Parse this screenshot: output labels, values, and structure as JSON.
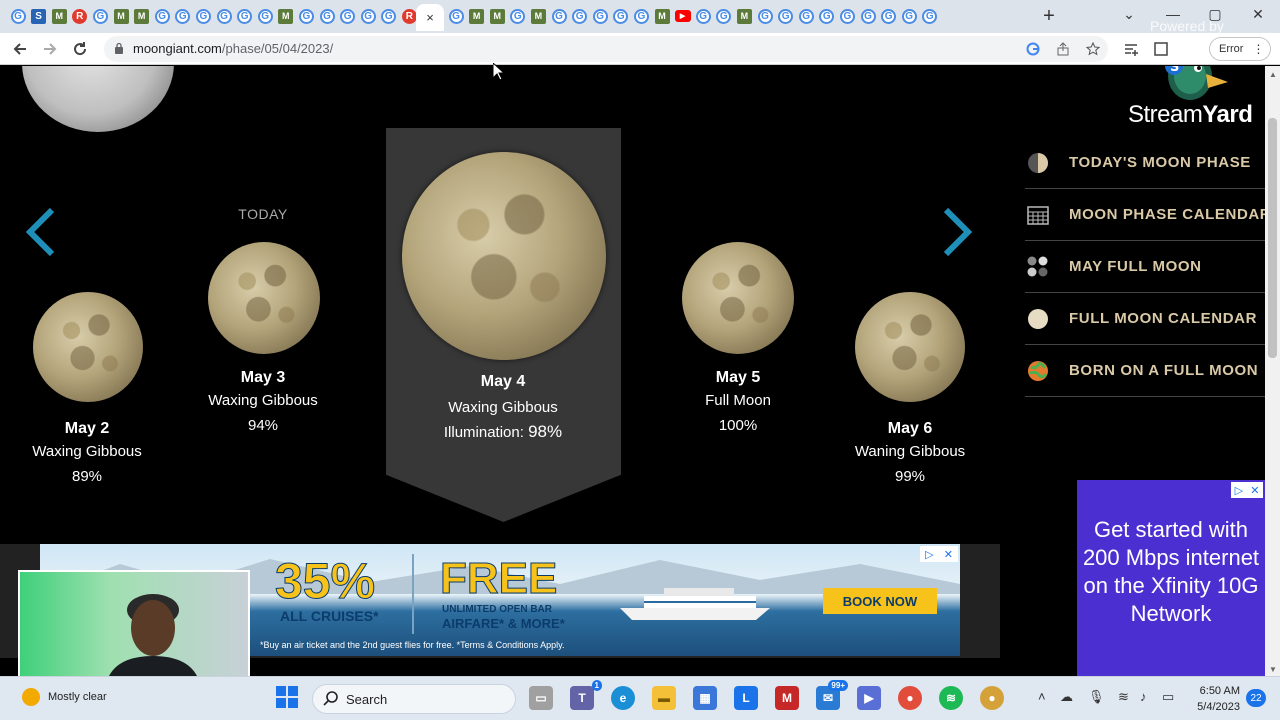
{
  "browser": {
    "tab_favicons": [
      "G",
      "S",
      "M",
      "R",
      "G",
      "M",
      "M",
      "G",
      "G",
      "G",
      "G",
      "G",
      "G",
      "M",
      "G",
      "G",
      "G",
      "G",
      "G",
      "R",
      "active",
      "G",
      "M",
      "M",
      "G",
      "M",
      "G",
      "G",
      "G",
      "G",
      "G",
      "M",
      "YT",
      "G",
      "G",
      "M",
      "G",
      "G",
      "G",
      "G",
      "G",
      "G",
      "G",
      "G",
      "G"
    ],
    "active_tab_close": "×",
    "new_tab": "+",
    "window_controls": {
      "minimize": "—",
      "maximize": "▢",
      "close": "✕",
      "dropdown": "⌄"
    },
    "overlay_text": "Powered by",
    "url_host": "moongiant.com",
    "url_path": "/phase/05/04/2023/",
    "error_chip": "Error"
  },
  "carousel": {
    "today_label": "TODAY",
    "days": [
      {
        "date": "May 2",
        "phase": "Waxing Gibbous",
        "illumination": "89%"
      },
      {
        "date": "May 3",
        "phase": "Waxing Gibbous",
        "illumination": "94%"
      },
      {
        "date": "May 4",
        "phase": "Waxing Gibbous",
        "illumination_label": "Illumination:",
        "illumination": "98%"
      },
      {
        "date": "May 5",
        "phase": "Full Moon",
        "illumination": "100%"
      },
      {
        "date": "May 6",
        "phase": "Waning Gibbous",
        "illumination": "99%"
      }
    ]
  },
  "sidebar": {
    "items": [
      {
        "label": "TODAY'S MOON PHASE",
        "icon": "half-moon-icon"
      },
      {
        "label": "MOON PHASE CALENDAR",
        "icon": "calendar-grid-icon"
      },
      {
        "label": "MAY FULL MOON",
        "icon": "moon-phases-icon"
      },
      {
        "label": "FULL MOON CALENDAR",
        "icon": "full-moon-icon"
      },
      {
        "label": "BORN ON A FULL MOON",
        "icon": "globe-icon"
      }
    ]
  },
  "streamyard": {
    "brand_light": "Stream",
    "brand_bold": "Yard"
  },
  "ad_banner": {
    "headline_pct": "35%",
    "headline_pct_sub": "ALL CRUISES*",
    "headline_free": "FREE",
    "free_line1": "UNLIMITED OPEN BAR",
    "free_line2": "AIRFARE* & MORE*",
    "fine_print": "*Buy an air ticket and the 2nd guest flies for free. *Terms & Conditions Apply.",
    "cta": "BOOK NOW"
  },
  "xfinity_ad": {
    "text": "Get started with 200 Mbps internet on the Xfinity 10G Network"
  },
  "taskbar": {
    "weather": "Mostly clear",
    "search_label": "Search",
    "mail_badge": "99+",
    "teams_badge": "1",
    "time": "6:50 AM",
    "date": "5/4/2023",
    "notifications": "22"
  },
  "colors": {
    "accent_blue": "#1e8fb8",
    "sidebar_text": "#d9c9a7",
    "featured_panel": "#373737",
    "xfinity_bg": "#4b2fd1"
  }
}
